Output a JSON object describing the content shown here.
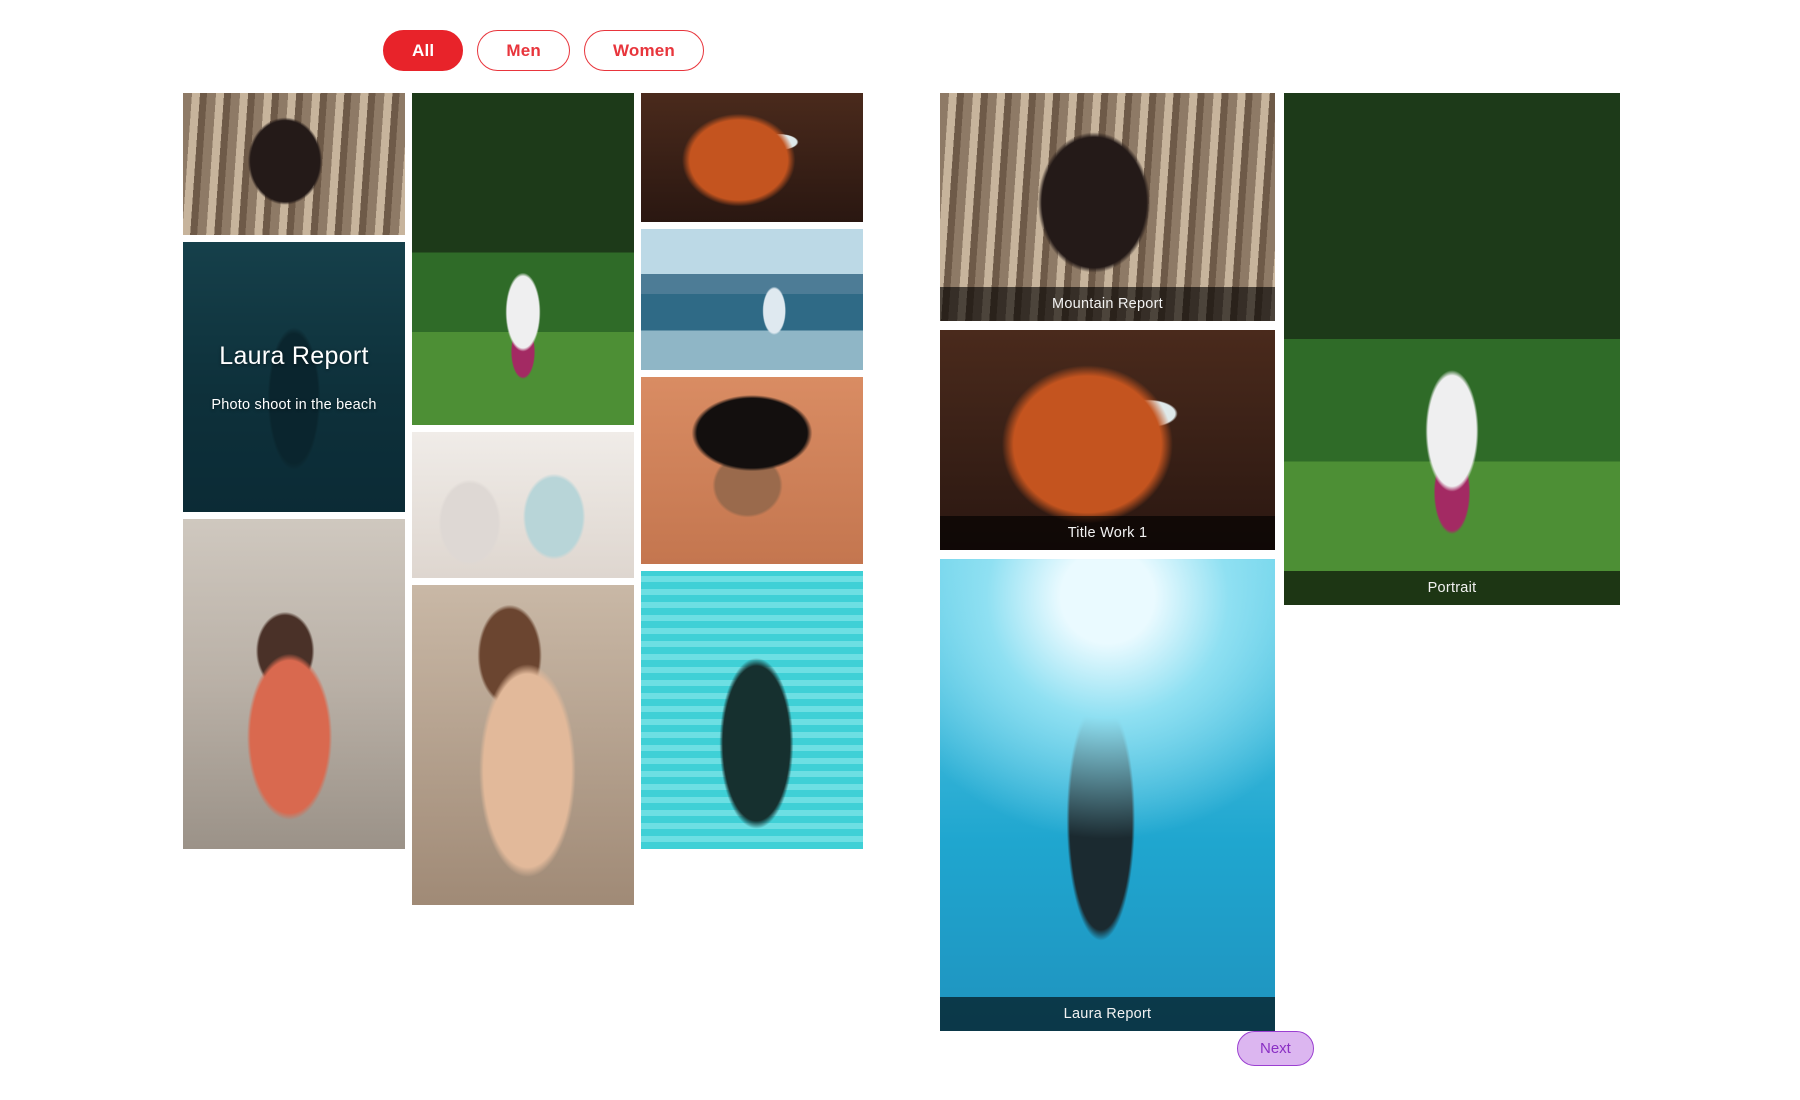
{
  "filters": {
    "items": [
      {
        "label": "All",
        "active": true
      },
      {
        "label": "Men",
        "active": false
      },
      {
        "label": "Women",
        "active": false
      }
    ],
    "accent_active_bg": "#e8232a",
    "accent_border": "#e8353c",
    "accent_text": "#e8353c"
  },
  "gallery_left": {
    "columns": [
      {
        "tiles": [
          {
            "alt": "Woman in black dress standing in sepia forest",
            "overlay": null
          },
          {
            "alt": "Woman walking underwater, dark teal tone",
            "overlay": {
              "title": "Laura Report",
              "subtitle": "Photo shoot in the beach"
            }
          },
          {
            "alt": "Woman in coral dress with round sunglasses sitting on street steps",
            "overlay": null
          }
        ]
      },
      {
        "tiles": [
          {
            "alt": "Woman on red chair in green orchard",
            "overlay": null
          },
          {
            "alt": "Two women shopping in a bright cafe boutique",
            "overlay": null
          },
          {
            "alt": "Woman with long brown hair in backless grey top",
            "overlay": null
          }
        ]
      },
      {
        "tiles": [
          {
            "alt": "Close-up of red-haired woman with freckles",
            "overlay": null
          },
          {
            "alt": "Man in tank top standing at a lake with mountains",
            "overlay": null
          },
          {
            "alt": "Man in black hat and sunglasses against terracotta wall",
            "overlay": null
          },
          {
            "alt": "Man in cap and dark polo in front of teal fence",
            "overlay": null
          }
        ]
      }
    ]
  },
  "gallery_right": {
    "columns": [
      {
        "tiles": [
          {
            "alt": "Woman in black dress standing in sepia forest",
            "caption": "Mountain Report"
          },
          {
            "alt": "Close-up of red-haired woman with freckles",
            "caption": "Title Work 1"
          },
          {
            "alt": "Woman walking underwater in bright blue water",
            "caption": "Laura Report"
          }
        ]
      },
      {
        "tiles": [
          {
            "alt": "Woman on red chair in green orchard",
            "caption": "Portrait"
          }
        ]
      }
    ]
  },
  "pagination": {
    "next_label": "Next",
    "next_bg": "#dcb6f0",
    "next_border": "#9b3fd1",
    "next_text": "#8a2fc4"
  }
}
